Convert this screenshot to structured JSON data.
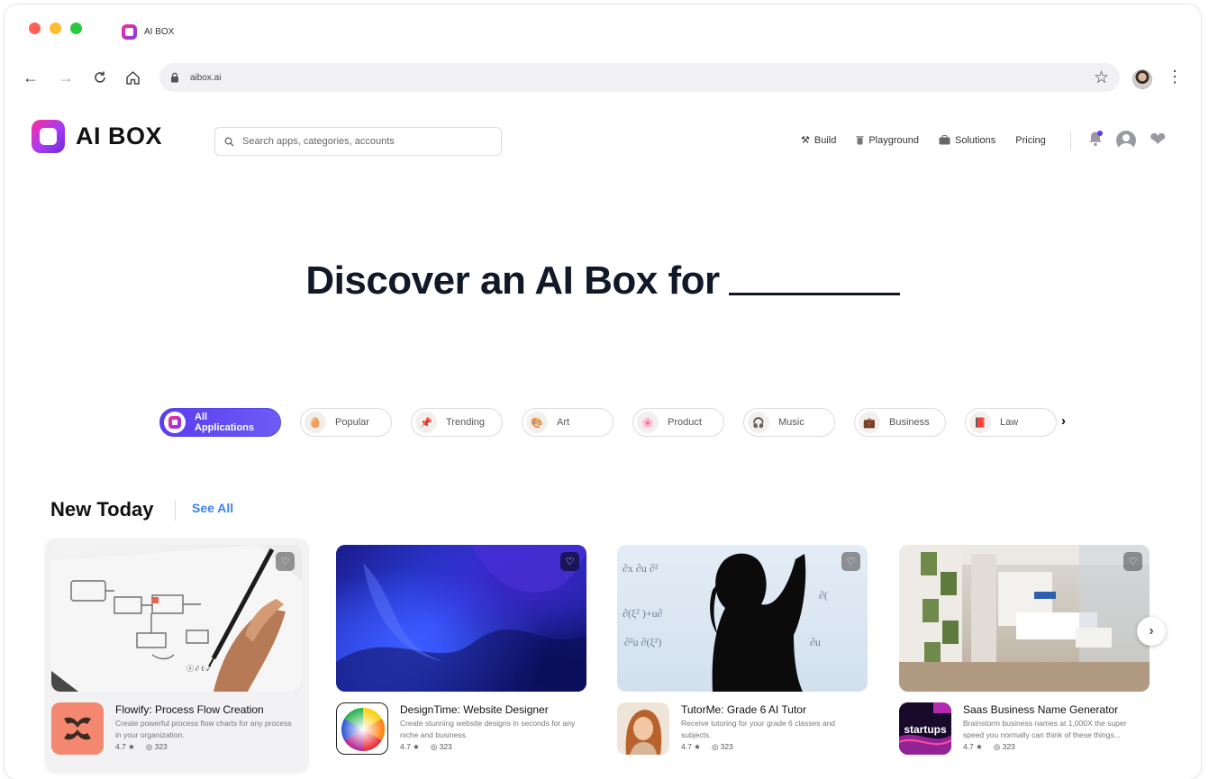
{
  "browser": {
    "tab_title": "AI BOX",
    "url": "aibox.ai"
  },
  "site": {
    "brand": "AI BOX",
    "search_placeholder": "Search apps, categories, accounts",
    "nav": [
      {
        "label": "Build",
        "icon": "tools-icon"
      },
      {
        "label": "Playground",
        "icon": "trash-can-icon"
      },
      {
        "label": "Solutions",
        "icon": "briefcase-icon"
      },
      {
        "label": "Pricing",
        "icon": ""
      }
    ]
  },
  "hero": {
    "title": "Discover an AI Box for"
  },
  "categories": [
    {
      "label": "All Applications",
      "icon": "aibox-logo-icon",
      "active": true
    },
    {
      "label": "Popular",
      "icon": "🥚"
    },
    {
      "label": "Trending",
      "icon": "📌"
    },
    {
      "label": "Art",
      "icon": "🎨"
    },
    {
      "label": "Product",
      "icon": "🌸"
    },
    {
      "label": "Music",
      "icon": "🎧"
    },
    {
      "label": "Business",
      "icon": "💼"
    },
    {
      "label": "Law",
      "icon": "📕"
    }
  ],
  "section": {
    "title": "New Today",
    "see_all": "See All"
  },
  "apps": [
    {
      "name": "Flowify: Process Flow Creation",
      "description": "Create powerful process flow charts for any process in your organization.",
      "rating": "4.7 ★",
      "views": "323"
    },
    {
      "name": "DesignTime: Website Designer",
      "description": "Create stunning website designs in seconds for any niche and business.",
      "rating": "4.7 ★",
      "views": "323"
    },
    {
      "name": "TutorMe: Grade 6 AI Tutor",
      "description": "Receive tutoring for your grade 6 classes and subjects.",
      "rating": "4.7 ★",
      "views": "323"
    },
    {
      "name": "Saas Business Name Generator",
      "description": "Brainstorm business names at 1,000X the super speed you normally can think of these things...",
      "rating": "4.7 ★",
      "views": "323",
      "icon_text": "startups"
    }
  ],
  "colors": {
    "accent": "#5b3cf0",
    "link": "#3b82f6",
    "text": "#111827"
  }
}
